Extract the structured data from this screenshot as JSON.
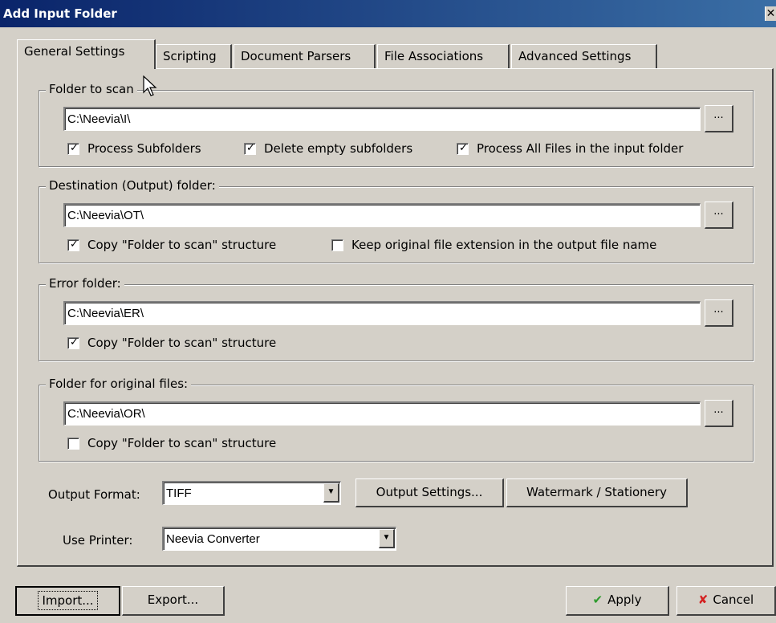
{
  "window": {
    "title": "Add Input Folder",
    "close_label": "✕"
  },
  "tabs": [
    {
      "label": "General Settings"
    },
    {
      "label": "Scripting"
    },
    {
      "label": "Document Parsers"
    },
    {
      "label": "File Associations"
    },
    {
      "label": "Advanced Settings"
    }
  ],
  "folder_to_scan": {
    "legend": "Folder to scan",
    "path": "C:\\Neevia\\I\\",
    "browse_label": "...",
    "options": [
      {
        "label": "Process Subfolders",
        "checked": true
      },
      {
        "label": "Delete empty subfolders",
        "checked": true
      },
      {
        "label": "Process All Files in the input folder",
        "checked": true
      }
    ]
  },
  "destination": {
    "legend": "Destination (Output) folder:",
    "path": "C:\\Neevia\\OT\\",
    "browse_label": "...",
    "options": [
      {
        "label": "Copy \"Folder to scan\" structure",
        "checked": true
      },
      {
        "label": "Keep original file extension in the output file name",
        "checked": false
      }
    ]
  },
  "error_folder": {
    "legend": "Error folder:",
    "path": "C:\\Neevia\\ER\\",
    "browse_label": "...",
    "options": [
      {
        "label": "Copy \"Folder to scan\" structure",
        "checked": true
      }
    ]
  },
  "original_files": {
    "legend": "Folder for original files:",
    "path": "C:\\Neevia\\OR\\",
    "browse_label": "...",
    "options": [
      {
        "label": "Copy \"Folder to scan\" structure",
        "checked": false
      }
    ]
  },
  "output_format": {
    "label": "Output Format:",
    "value": "TIFF",
    "settings_button": "Output Settings...",
    "watermark_button": "Watermark / Stationery"
  },
  "printer": {
    "label": "Use Printer:",
    "value": "Neevia Converter"
  },
  "footer": {
    "import_label": "Import...",
    "export_label": "Export...",
    "apply_label": "Apply",
    "cancel_label": "Cancel"
  },
  "colors": {
    "titlebar": "#0a246a",
    "face": "#d4d0c8",
    "apply_icon": "#2e9b2e",
    "cancel_icon": "#d42020"
  }
}
